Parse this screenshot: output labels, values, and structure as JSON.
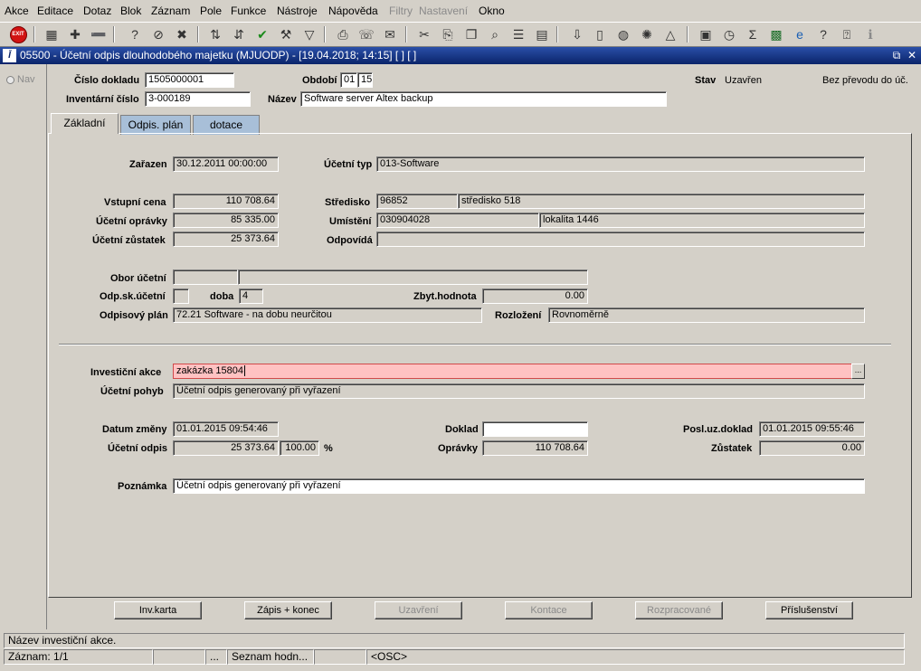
{
  "menu": [
    "Akce",
    "Editace",
    "Dotaz",
    "Blok",
    "Záznam",
    "Pole",
    "Funkce",
    "Nástroje",
    "Nápověda",
    "Filtry",
    "Nastavení",
    "Okno"
  ],
  "menu_disabled": [
    "Filtry",
    "Nastavení"
  ],
  "toolbar": {
    "exit_label": "EXIT",
    "icons": [
      "exit-icon",
      "add-record-icon",
      "new-record-icon",
      "remove-record-icon",
      "query-icon",
      "query-cancel-icon",
      "delete-record-icon",
      "sort-asc-icon",
      "sort-desc-icon",
      "commit-check-icon",
      "wrench-icon",
      "filter-icon",
      "print-icon",
      "fax-icon",
      "mail-icon",
      "cut-icon",
      "paste-icon",
      "copy-icon",
      "zoom-icon",
      "list-icon",
      "grid-icon",
      "import-icon",
      "document-icon",
      "globe-icon",
      "network-icon",
      "chart-icon",
      "form-icon",
      "clock-icon",
      "sum-icon",
      "excel-icon",
      "explorer-icon",
      "help-question-icon",
      "help-context-icon",
      "info-icon"
    ]
  },
  "window": {
    "title": "05500 - Účetní odpis dlouhodobého majetku (MJUODP) - [19.04.2018; 14:15]  [ ] [ ]",
    "logo": "Ī",
    "restore": "⧉",
    "close": "✕"
  },
  "nav": {
    "label": "Nav"
  },
  "header": {
    "cislo_dokladu_label": "Číslo dokladu",
    "cislo_dokladu": "1505000001",
    "obdobi_label": "Období",
    "obdobi_month": "01",
    "obdobi_year": "15",
    "stav_label": "Stav",
    "stav": "Uzavřen",
    "prevod": "Bez převodu do úč.",
    "inv_cislo_label": "Inventární číslo",
    "inv_cislo": "3-000189",
    "nazev_label": "Název",
    "nazev": "Software server Altex backup"
  },
  "tabs": [
    "Základní",
    "Odpis. plán",
    "dotace"
  ],
  "form": {
    "zarazen_label": "Zařazen",
    "zarazen": "30.12.2011 00:00:00",
    "ucetni_typ_label": "Účetní typ",
    "ucetni_typ": "013-Software",
    "vstupni_cena_label": "Vstupní cena",
    "vstupni_cena": "110 708.64",
    "stredisko_label": "Středisko",
    "stredisko_kod": "96852",
    "stredisko_nazev": "středisko 518",
    "ucetni_opravky_label": "Účetní oprávky",
    "ucetni_opravky": "85 335.00",
    "umisteni_label": "Umístění",
    "umisteni_kod": "030904028",
    "umisteni_nazev": "lokalita 1446",
    "ucetni_zustatek_label": "Účetní zůstatek",
    "ucetni_zustatek": "25 373.64",
    "odpovida_label": "Odpovídá",
    "odpovida": "",
    "obor_label": "Obor účetní",
    "obor_kod": "",
    "obor_nazev": "",
    "odp_sk_label": "Odp.sk.účetní",
    "odp_sk": "",
    "doba_label": "doba",
    "doba": "4",
    "zbyt_label": "Zbyt.hodnota",
    "zbyt": "0.00",
    "odpisovy_plan_label": "Odpisový plán",
    "odpisovy_plan": "72.21 Software - na dobu neurčitou",
    "rozlozeni_label": "Rozložení",
    "rozlozeni": "Rovnoměrně",
    "invest_akce_label": "Investiční akce",
    "invest_akce": "zakázka 15804",
    "lov_label": "...",
    "ucetni_pohyb_label": "Účetní pohyb",
    "ucetni_pohyb": "Účetní odpis generovaný při vyřazení",
    "datum_zmeny_label": "Datum změny",
    "datum_zmeny": "01.01.2015 09:54:46",
    "doklad_label": "Doklad",
    "doklad": "",
    "posl_uz_label": "Posl.uz.doklad",
    "posl_uz": "01.01.2015 09:55:46",
    "ucetni_odpis_label": "Účetní odpis",
    "ucetni_odpis": "25 373.64",
    "ucetni_odpis_pct": "100.00",
    "pct_sign": "%",
    "opravky_label": "Oprávky",
    "opravky": "110 708.64",
    "zustatek_label": "Zůstatek",
    "zustatek": "0.00",
    "poznamka_label": "Poznámka",
    "poznamka": "Účetní odpis generovaný při vyřazení"
  },
  "buttons": {
    "inv_karta": "Inv.karta",
    "zapis_konec": "Zápis + konec",
    "uzavreni": "Uzavření",
    "kontace": "Kontace",
    "rozpracovane": "Rozpracované",
    "prislusenstvi": "Příslušenství"
  },
  "status": {
    "message": "Název investiční akce.",
    "record": "Záznam: 1/1",
    "seg2": "",
    "seg3": "...",
    "lov": "Seznam hodn...",
    "seg5": "",
    "mode": "<OSC>"
  }
}
